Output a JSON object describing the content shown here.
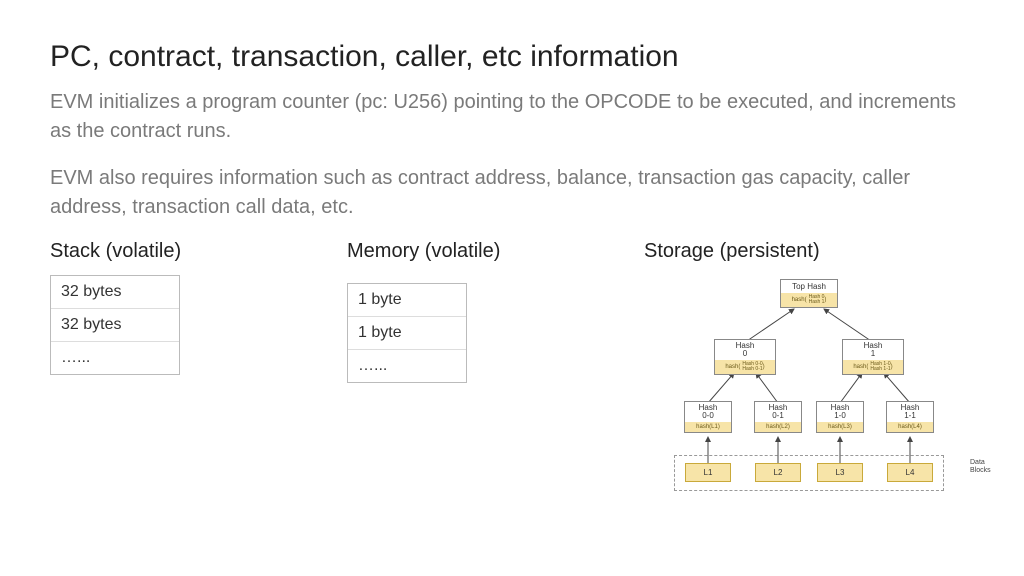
{
  "title": "PC, contract, transaction, caller, etc information",
  "para1": "EVM initializes a program counter (pc: U256) pointing to the OPCODE to be executed, and increments as the contract runs.",
  "para2": "EVM also requires information such as contract address, balance, transaction gas capacity, caller address, transaction call data, etc.",
  "stack": {
    "heading": "Stack (volatile)",
    "rows": [
      "32 bytes",
      "32 bytes",
      "…..."
    ]
  },
  "memory": {
    "heading": "Memory (volatile)",
    "rows": [
      "1 byte",
      "1 byte",
      "…..."
    ]
  },
  "storage": {
    "heading": "Storage (persistent)",
    "tree": {
      "top": {
        "label": "Top Hash",
        "hash_prefix": "hash(",
        "hash_lines": "Hash 0\nHash 1"
      },
      "h0": {
        "label": "Hash\n0",
        "hash_prefix": "hash(",
        "hash_lines": "Hash 0-0\nHash 0-1"
      },
      "h1": {
        "label": "Hash\n1",
        "hash_prefix": "hash(",
        "hash_lines": "Hash 1-0\nHash 1-1"
      },
      "h00": {
        "label": "Hash\n0-0",
        "hash": "hash(L1)"
      },
      "h01": {
        "label": "Hash\n0-1",
        "hash": "hash(L2)"
      },
      "h10": {
        "label": "Hash\n1-0",
        "hash": "hash(L3)"
      },
      "h11": {
        "label": "Hash\n1-1",
        "hash": "hash(L4)"
      },
      "leaves": [
        "L1",
        "L2",
        "L3",
        "L4"
      ],
      "blocks_label": "Data\nBlocks"
    }
  }
}
